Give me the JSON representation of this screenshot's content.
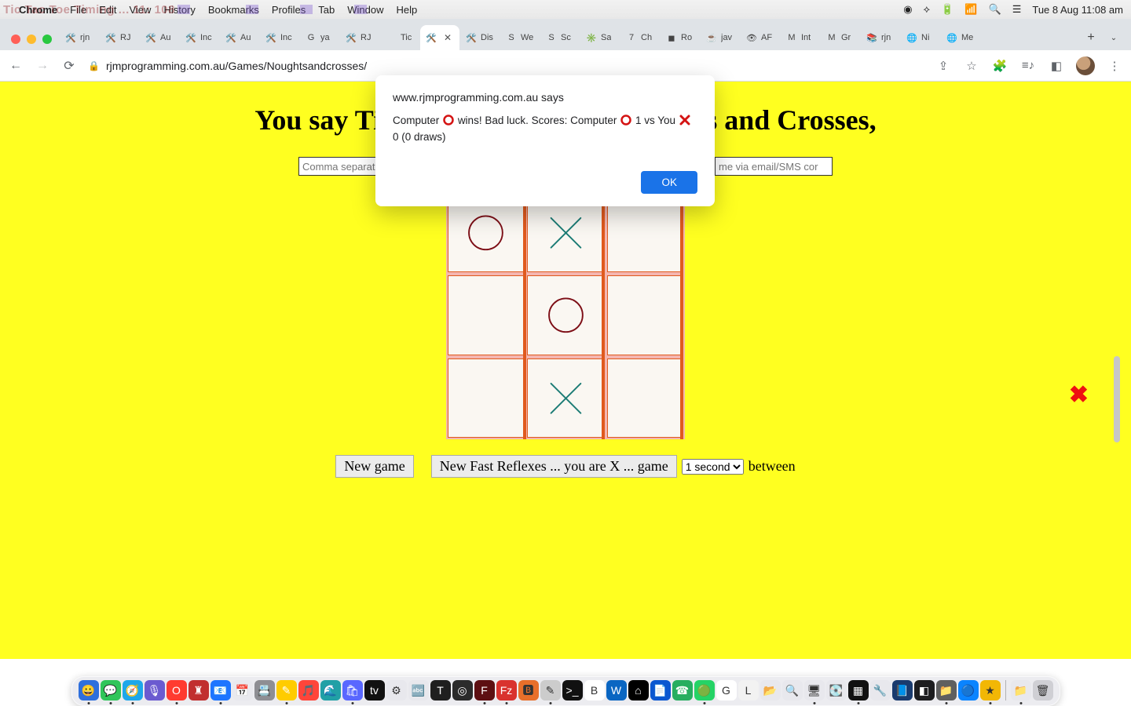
{
  "menubar": {
    "app": "Chrome",
    "items": [
      "File",
      "Edit",
      "View",
      "History",
      "Bookmarks",
      "Profiles",
      "Tab",
      "Window",
      "Help"
    ],
    "ghost": "Tic Tac Toe Timing ... 11:        108",
    "clock": "Tue 8 Aug  11:08 am"
  },
  "tabs": {
    "list": [
      {
        "label": "rjn",
        "ico": "🛠️"
      },
      {
        "label": "RJ",
        "ico": "🛠️"
      },
      {
        "label": "Au",
        "ico": "🛠️"
      },
      {
        "label": "Inc",
        "ico": "🛠️"
      },
      {
        "label": "Au",
        "ico": "🛠️"
      },
      {
        "label": "Inc",
        "ico": "🛠️"
      },
      {
        "label": "ya",
        "ico": "G"
      },
      {
        "label": "RJ",
        "ico": "🛠️"
      },
      {
        "label": "Tic",
        "ico": ""
      },
      {
        "label": "",
        "ico": "🛠️",
        "active": true
      },
      {
        "label": "Dis",
        "ico": "🛠️"
      },
      {
        "label": "We",
        "ico": "S"
      },
      {
        "label": "Sc",
        "ico": "S"
      },
      {
        "label": "Sa",
        "ico": "✳️"
      },
      {
        "label": "Ch",
        "ico": "7"
      },
      {
        "label": "Ro",
        "ico": "◼"
      },
      {
        "label": "jav",
        "ico": "☕"
      },
      {
        "label": "AF",
        "ico": "👁"
      },
      {
        "label": "Int",
        "ico": "M"
      },
      {
        "label": "Gr",
        "ico": "M"
      },
      {
        "label": "rjn",
        "ico": "📚"
      },
      {
        "label": "Ni",
        "ico": "🌐"
      },
      {
        "label": "Me",
        "ico": "🌐"
      }
    ],
    "overflow": "⌄"
  },
  "toolbar": {
    "back": "←",
    "fwd": "→",
    "reload": "⟳",
    "url": "rjmprogramming.com.au/Games/Noughtsandcrosses/",
    "share": "⇪",
    "star": "☆",
    "ext": "🧩",
    "media": "≡♪",
    "panel": "◧",
    "menu": "⋮"
  },
  "page": {
    "heading": "You say Tic Tac Toe and I say Noughts and Crosses,",
    "input_left_placeholder": "Comma separated re",
    "input_right_placeholder": "me via email/SMS cor",
    "board": [
      "O",
      "X",
      "",
      "",
      "O",
      "",
      "",
      "X",
      ""
    ],
    "btn_new_game": "New game",
    "btn_fast": "New Fast Reflexes ... you are X ... game",
    "select_value": "1 second",
    "between_label": "between"
  },
  "alert": {
    "origin": "www.rjmprogramming.com.au says",
    "l1a": "Computer",
    "l1b": "wins!   Bad luck.  Scores: Computer",
    "l1c": "1 vs You",
    "l2": "0 (0 draws)",
    "ok": "OK"
  },
  "dock": {
    "apps": [
      {
        "bg": "#2e6fdc",
        "t": "😀"
      },
      {
        "bg": "#30c55a",
        "t": "💬"
      },
      {
        "bg": "#1ea7ea",
        "t": "🧭"
      },
      {
        "bg": "#6b5bd0",
        "t": "🎙"
      },
      {
        "bg": "#ff3b30",
        "t": "O"
      },
      {
        "bg": "#c12f2f",
        "t": "♜"
      },
      {
        "bg": "#1d75ff",
        "t": "📧"
      },
      {
        "bg": "#e9e9ee",
        "t": "📅"
      },
      {
        "bg": "#8e8e93",
        "t": "📇"
      },
      {
        "bg": "#ffcc00",
        "t": "✎"
      },
      {
        "bg": "#ff453a",
        "t": "🎵"
      },
      {
        "bg": "#21a0a6",
        "t": "🌊"
      },
      {
        "bg": "#5967ff",
        "t": "🛍"
      },
      {
        "bg": "#111",
        "t": "tv"
      },
      {
        "bg": "#e8e8ed",
        "t": "⚙"
      },
      {
        "bg": "#e8e8ed",
        "t": "🔤"
      },
      {
        "bg": "#1f1f1f",
        "t": "T"
      },
      {
        "bg": "#2b2b2b",
        "t": "◎"
      },
      {
        "bg": "#5d0f12",
        "t": "F"
      },
      {
        "bg": "#d9322e",
        "t": "Fz"
      },
      {
        "bg": "#e86f2a",
        "t": "🅱"
      },
      {
        "bg": "#cccccc",
        "t": "✎"
      },
      {
        "bg": "#111",
        "t": ">_"
      },
      {
        "bg": "#fff",
        "t": "B"
      },
      {
        "bg": "#0a66c2",
        "t": "W"
      },
      {
        "bg": "#000",
        "t": "⌂"
      },
      {
        "bg": "#0b57d0",
        "t": "📄"
      },
      {
        "bg": "#27ae60",
        "t": "☎"
      },
      {
        "bg": "#25d366",
        "t": "🟢"
      },
      {
        "bg": "#ffffff",
        "t": "G"
      },
      {
        "bg": "#f2f2f2",
        "t": "L"
      },
      {
        "bg": "#e8e8ed",
        "t": "📂"
      },
      {
        "bg": "#e8e8ed",
        "t": "🔍"
      },
      {
        "bg": "#e8e8ed",
        "t": "🖥"
      },
      {
        "bg": "#e8e8ed",
        "t": "💽"
      },
      {
        "bg": "#111",
        "t": "▦"
      },
      {
        "bg": "#e8e8ed",
        "t": "🔧"
      },
      {
        "bg": "#1a3b6e",
        "t": "📘"
      },
      {
        "bg": "#1d1d1f",
        "t": "◧"
      },
      {
        "bg": "#5f5f5f",
        "t": "📁"
      },
      {
        "bg": "#0a84ff",
        "t": "🔵"
      },
      {
        "bg": "#f2b705",
        "t": "★"
      },
      {
        "bg": "#e8e8ed",
        "t": "📁"
      },
      {
        "bg": "#cfcfd4",
        "t": "🗑"
      }
    ]
  }
}
